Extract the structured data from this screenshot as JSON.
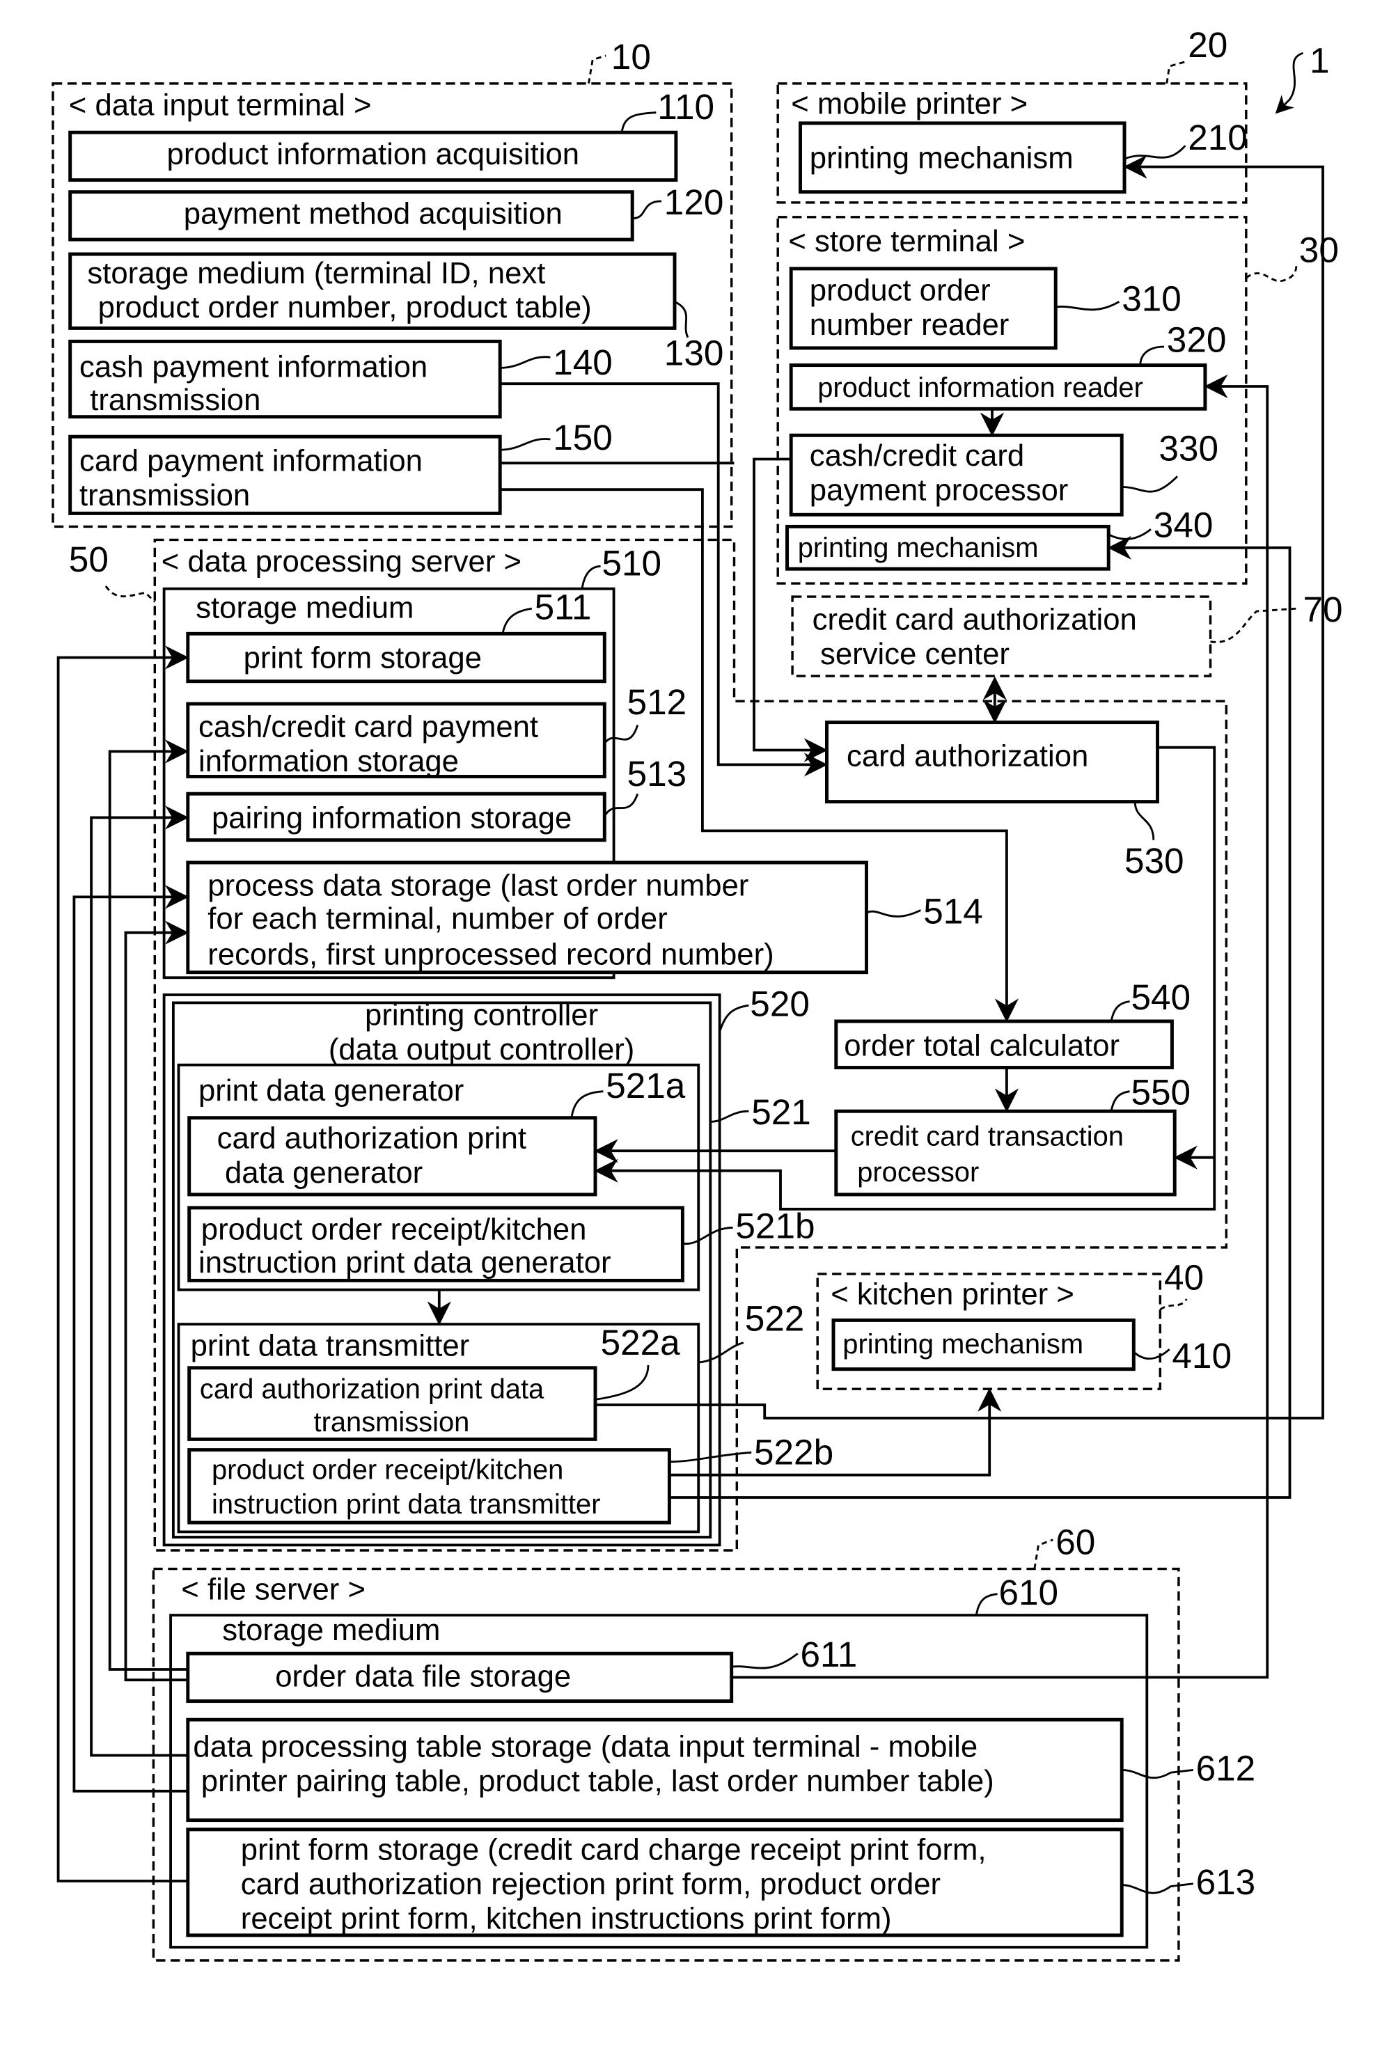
{
  "figure_ref": "1",
  "data_input_terminal": {
    "ref": "10",
    "title": "< data input terminal >",
    "product_info_acquisition": {
      "ref": "110",
      "label": "product information acquisition"
    },
    "payment_method_acquisition": {
      "ref": "120",
      "label": "payment method acquisition"
    },
    "storage_medium": {
      "ref": "130",
      "lines": [
        "storage medium (terminal ID, next",
        "product order number, product table)"
      ]
    },
    "cash_payment_tx": {
      "ref": "140",
      "lines": [
        "cash payment information",
        "transmission"
      ]
    },
    "card_payment_tx": {
      "ref": "150",
      "lines": [
        "card payment information",
        "transmission"
      ]
    }
  },
  "mobile_printer": {
    "ref": "20",
    "title": "< mobile printer >",
    "printing_mechanism": {
      "ref": "210",
      "label": "printing mechanism"
    }
  },
  "store_terminal": {
    "ref": "30",
    "title": "< store terminal >",
    "order_number_reader": {
      "ref": "310",
      "lines": [
        "product order",
        "number reader"
      ]
    },
    "product_info_reader": {
      "ref": "320",
      "label": "product information reader"
    },
    "payment_processor": {
      "ref": "330",
      "lines": [
        "cash/credit card",
        "payment processor"
      ]
    },
    "printing_mechanism": {
      "ref": "340",
      "label": "printing mechanism"
    }
  },
  "auth_service_center": {
    "ref": "70",
    "lines": [
      "credit card authorization",
      "service center"
    ]
  },
  "data_processing_server": {
    "ref": "50",
    "title": "< data processing server >",
    "storage_medium": {
      "ref": "510",
      "label": "storage medium",
      "print_form_storage": {
        "ref": "511",
        "label": "print form storage"
      },
      "payment_info_storage": {
        "ref": "512",
        "lines": [
          "cash/credit card payment",
          "information storage"
        ]
      },
      "pairing_info_storage": {
        "ref": "513",
        "label": "pairing information storage"
      },
      "process_data_storage": {
        "ref": "514",
        "lines": [
          "process data storage (last order number",
          "for each terminal, number of order",
          "records, first unprocessed record number)"
        ]
      }
    },
    "card_authorization": {
      "ref": "530",
      "label": "card authorization"
    },
    "order_total_calculator": {
      "ref": "540",
      "label": "order total calculator"
    },
    "credit_card_tx_processor": {
      "ref": "550",
      "lines": [
        "credit card transaction",
        "processor"
      ]
    },
    "printing_controller": {
      "ref": "520",
      "lines": [
        "printing controller",
        "(data output controller)"
      ],
      "print_data_generator": {
        "ref": "521",
        "label": "print data generator",
        "card_auth_gen": {
          "ref": "521a",
          "lines": [
            "card authorization print",
            "data generator"
          ]
        },
        "receipt_kitchen_gen": {
          "ref": "521b",
          "lines": [
            "product order receipt/kitchen",
            "instruction print data generator"
          ]
        }
      },
      "print_data_transmitter": {
        "ref": "522",
        "label": "print data transmitter",
        "card_auth_tx": {
          "ref": "522a",
          "lines": [
            "card authorization print data",
            "transmission"
          ]
        },
        "receipt_kitchen_tx": {
          "ref": "522b",
          "lines": [
            "product order receipt/kitchen",
            "instruction print data transmitter"
          ]
        }
      }
    }
  },
  "kitchen_printer": {
    "ref": "40",
    "title": "< kitchen printer >",
    "printing_mechanism": {
      "ref": "410",
      "label": "printing mechanism"
    }
  },
  "file_server": {
    "ref": "60",
    "title": "< file server >",
    "storage_medium": {
      "ref": "610",
      "label": "storage medium",
      "order_data_file_storage": {
        "ref": "611",
        "label": "order data file storage"
      },
      "table_storage": {
        "ref": "612",
        "lines": [
          "data processing table storage (data input terminal - mobile",
          "printer pairing table, product table, last order number table)"
        ]
      },
      "print_form_storage": {
        "ref": "613",
        "lines": [
          "print form storage (credit card charge receipt print form,",
          "card authorization rejection print form, product order",
          "receipt print form, kitchen instructions print form)"
        ]
      }
    }
  }
}
